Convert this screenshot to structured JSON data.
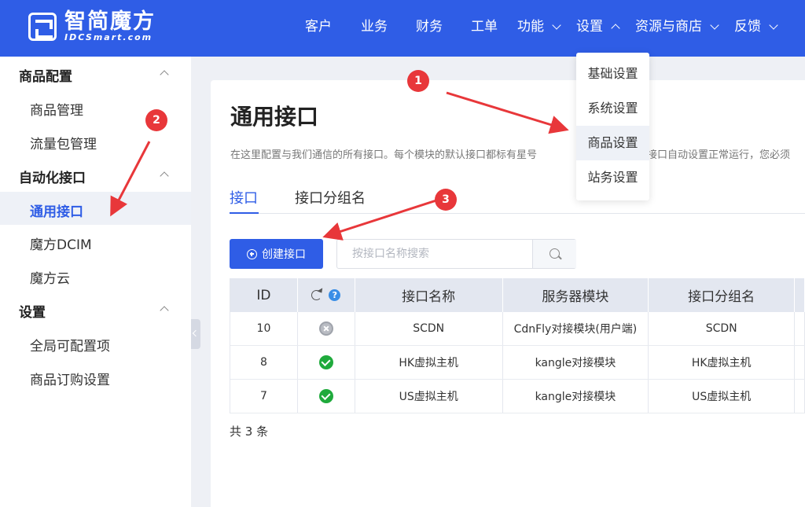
{
  "brand": {
    "name_cn": "智简魔方",
    "name_en": "IDCSmart.com"
  },
  "nav": {
    "items": [
      {
        "label": "客户",
        "chevron": ""
      },
      {
        "label": "业务",
        "chevron": ""
      },
      {
        "label": "财务",
        "chevron": ""
      },
      {
        "label": "工单",
        "chevron": ""
      },
      {
        "label": "功能",
        "chevron": "down"
      },
      {
        "label": "设置",
        "chevron": "up"
      },
      {
        "label": "资源与商店",
        "chevron": "down"
      },
      {
        "label": "反馈",
        "chevron": "down"
      }
    ]
  },
  "dropdown": {
    "items": [
      {
        "label": "基础设置",
        "active": false
      },
      {
        "label": "系统设置",
        "active": false
      },
      {
        "label": "商品设置",
        "active": true
      },
      {
        "label": "站务设置",
        "active": false
      }
    ]
  },
  "sidebar": {
    "groups": [
      {
        "title": "商品配置",
        "items": [
          "商品管理",
          "流量包管理"
        ]
      },
      {
        "title": "自动化接口",
        "items": [
          "通用接口",
          "魔方DCIM",
          "魔方云"
        ]
      },
      {
        "title": "设置",
        "items": [
          "全局可配置项",
          "商品订购设置"
        ]
      }
    ],
    "active_item": "通用接口"
  },
  "main": {
    "title": "通用接口",
    "description_left": "在这里配置与我们通信的所有接口。每个模块的默认接口都标有星号",
    "description_right": "接口自动设置正常运行，您必须",
    "tabs": [
      {
        "label": "接口",
        "active": true
      },
      {
        "label": "接口分组名",
        "active": false
      }
    ],
    "create_button": "创建接口",
    "search_placeholder": "按接口名称搜索",
    "table": {
      "headers": [
        "ID",
        "",
        "接口名称",
        "服务器模块",
        "接口分组名"
      ],
      "rows": [
        {
          "id": "10",
          "status": "error",
          "name": "SCDN",
          "module": "CdnFly对接模块(用户端)",
          "group": "SCDN"
        },
        {
          "id": "8",
          "status": "ok",
          "name": "HK虚拟主机",
          "module": "kangle对接模块",
          "group": "HK虚拟主机"
        },
        {
          "id": "7",
          "status": "ok",
          "name": "US虚拟主机",
          "module": "kangle对接模块",
          "group": "US虚拟主机"
        }
      ]
    },
    "total": "共 3 条",
    "help_glyph": "?"
  },
  "annotations": [
    "1",
    "2",
    "3"
  ],
  "colors": {
    "primary": "#2f5de6",
    "annotation": "#e8373a",
    "ok": "#1faa3c",
    "error": "#b9bcc3"
  }
}
